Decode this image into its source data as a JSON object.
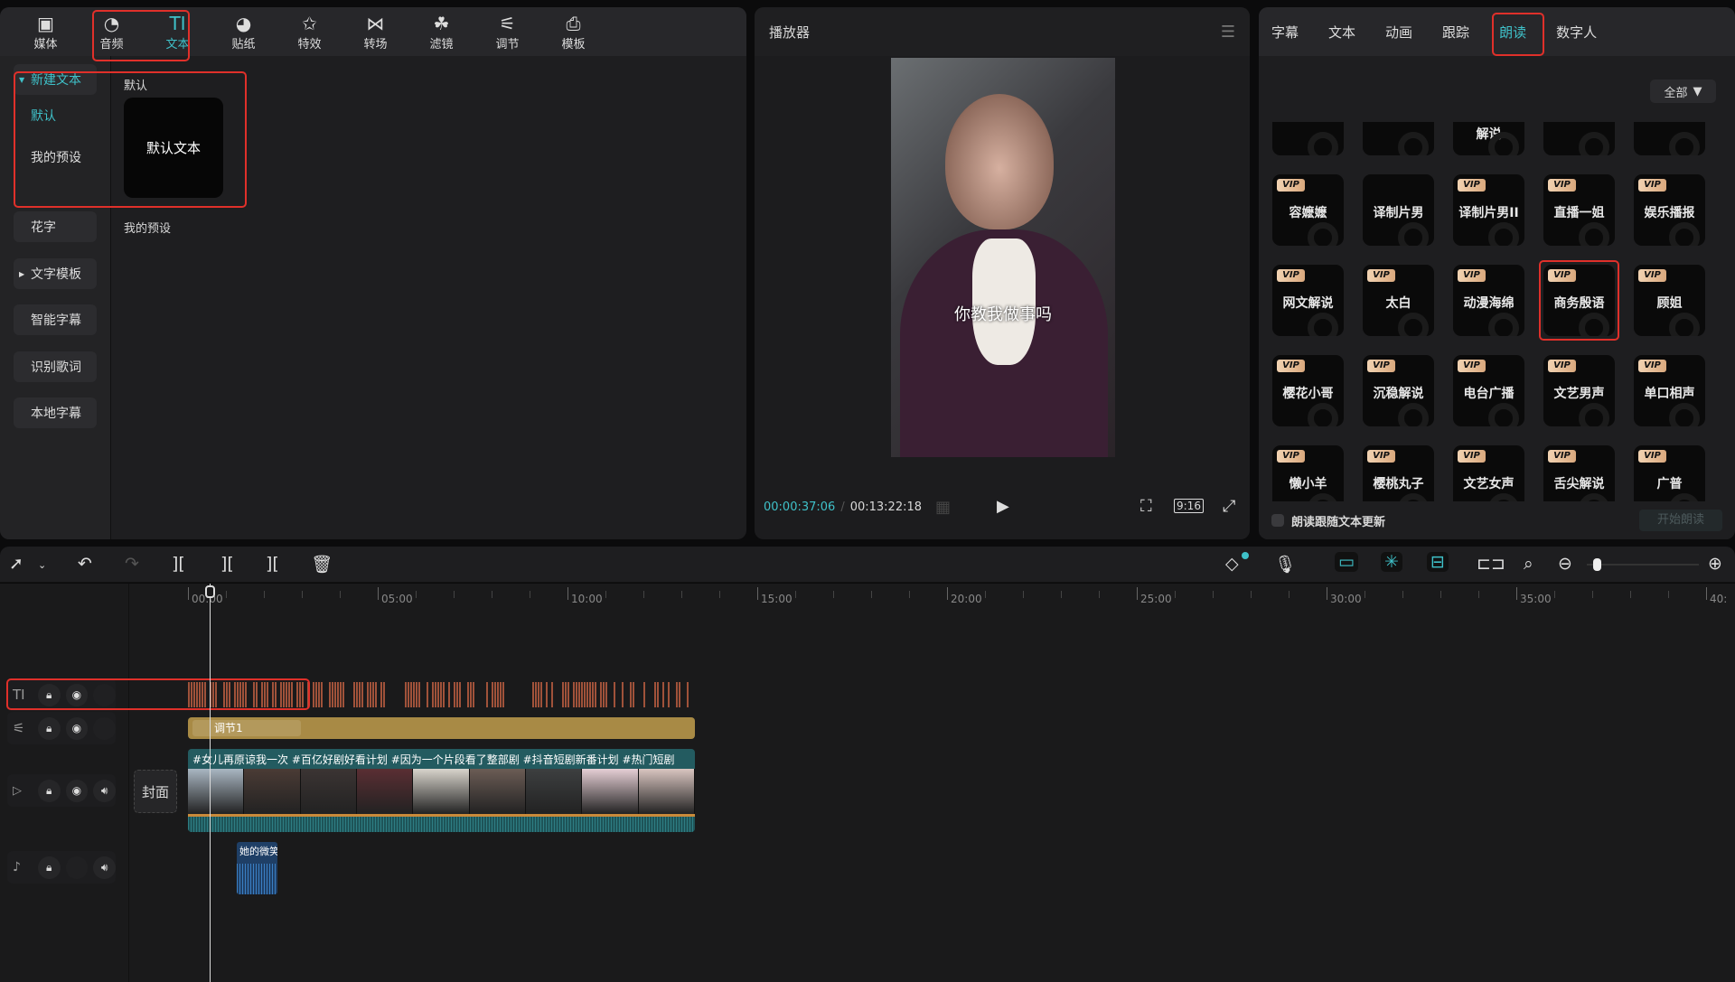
{
  "left_panel": {
    "tools": [
      {
        "label": "媒体",
        "icon": "media-icon"
      },
      {
        "label": "音频",
        "icon": "audio-icon"
      },
      {
        "label": "文本",
        "icon": "text-icon",
        "active": true
      },
      {
        "label": "贴纸",
        "icon": "sticker-icon"
      },
      {
        "label": "特效",
        "icon": "effects-icon"
      },
      {
        "label": "转场",
        "icon": "transition-icon"
      },
      {
        "label": "滤镜",
        "icon": "filter-icon"
      },
      {
        "label": "调节",
        "icon": "adjust-icon"
      },
      {
        "label": "模板",
        "icon": "template-icon"
      }
    ],
    "sidebar": {
      "new_text": "新建文本",
      "default": "默认",
      "my_presets": "我的预设",
      "fancy": "花字",
      "text_template": "文字模板",
      "smart_caption": "智能字幕",
      "lyrics": "识别歌词",
      "local_caption": "本地字幕"
    },
    "content": {
      "section_default": "默认",
      "default_card": "默认文本",
      "section_presets": "我的预设"
    }
  },
  "player": {
    "title": "播放器",
    "subtitle": "你教我做事吗",
    "current_time": "00:00:37:06",
    "separator": "/",
    "total_time": "00:13:22:18",
    "ratio": "9:16"
  },
  "right_panel": {
    "tabs": [
      "字幕",
      "文本",
      "动画",
      "跟踪",
      "朗读",
      "数字人"
    ],
    "active_tab": "朗读",
    "filter_label": "全部",
    "vip_label": "VIP",
    "partial_row": [
      "",
      "",
      "解说",
      "",
      ""
    ],
    "voices": [
      [
        {
          "name": "容嬷嬷",
          "vip": true
        },
        {
          "name": "译制片男",
          "vip": false
        },
        {
          "name": "译制片男II",
          "vip": true
        },
        {
          "name": "直播一姐",
          "vip": true
        },
        {
          "name": "娱乐播报",
          "vip": true
        }
      ],
      [
        {
          "name": "网文解说",
          "vip": true
        },
        {
          "name": "太白",
          "vip": true
        },
        {
          "name": "动漫海绵",
          "vip": true
        },
        {
          "name": "商务殷语",
          "vip": true,
          "selected": true
        },
        {
          "name": "顾姐",
          "vip": true
        }
      ],
      [
        {
          "name": "樱花小哥",
          "vip": true
        },
        {
          "name": "沉稳解说",
          "vip": true
        },
        {
          "name": "电台广播",
          "vip": true
        },
        {
          "name": "文艺男声",
          "vip": true
        },
        {
          "name": "单口相声",
          "vip": true
        }
      ],
      [
        {
          "name": "懒小羊",
          "vip": true
        },
        {
          "name": "樱桃丸子",
          "vip": true
        },
        {
          "name": "文艺女声",
          "vip": true
        },
        {
          "name": "舌尖解说",
          "vip": true
        },
        {
          "name": "广普",
          "vip": true
        }
      ]
    ],
    "follow_text": "朗读跟随文本更新",
    "follow_checked": false,
    "start_button": "开始朗读"
  },
  "timeline": {
    "ruler": [
      "00:00",
      "05:00",
      "10:00",
      "15:00",
      "20:00",
      "25:00",
      "30:00",
      "35:00",
      "40:"
    ],
    "adjust_clip": "调节1",
    "cover": "封面",
    "video_clip_title": "#女儿再原谅我一次 #百亿好剧好看计划 #因为一个片段看了整部剧 #抖音短剧新番计划 #热门短剧",
    "audio_clip": "她的微笑",
    "zoom_level": 0.06
  },
  "colors": {
    "accent": "#3fc1c9",
    "highlight": "#e0302a",
    "text_clip": "#a0523a",
    "adjust_clip": "#a88a45",
    "video_clip": "#235b60",
    "audio_clip": "#1f3f66",
    "vip": "#e6bc95"
  }
}
